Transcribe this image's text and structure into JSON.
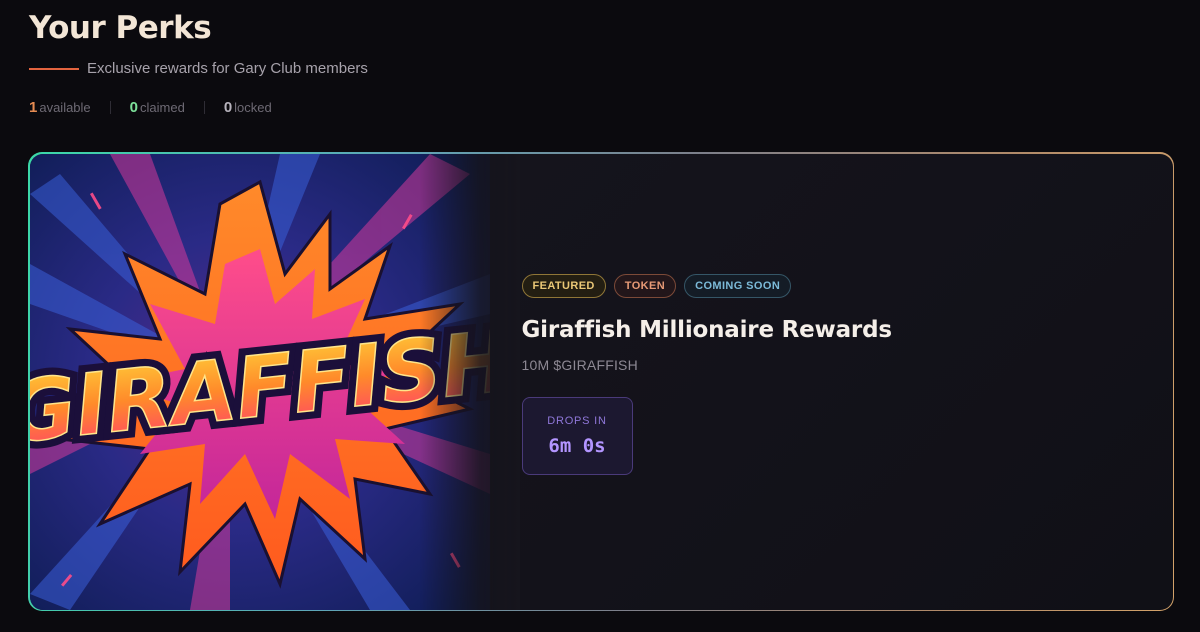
{
  "header": {
    "title": "Your Perks",
    "subtitle": "Exclusive rewards for Gary Club members"
  },
  "stats": [
    {
      "count": "1",
      "label": "available",
      "color": "#e58b52"
    },
    {
      "count": "0",
      "label": "claimed",
      "color": "#7de19a"
    },
    {
      "count": "0",
      "label": "locked",
      "color": "#b7b3bc"
    }
  ],
  "perk": {
    "image_text": "GIRAFFISH",
    "badges": [
      "FEATURED",
      "TOKEN",
      "COMING SOON"
    ],
    "title": "Giraffish Millionaire Rewards",
    "amount": "10M $GIRAFFISH",
    "countdown": {
      "label": "DROPS IN",
      "value": "6m 0s"
    }
  },
  "colors": {
    "accent": "#e3643f",
    "countdown": "#b395ff",
    "card_border_start": "#3bd8a8",
    "card_border_end": "#d4a36a"
  }
}
